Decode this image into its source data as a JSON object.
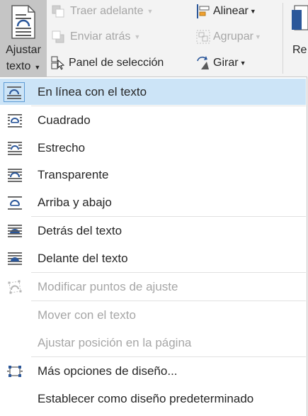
{
  "ribbon": {
    "ajustar_texto": {
      "line1": "Ajustar",
      "line2": "texto",
      "icon": "wrap-text-icon"
    },
    "traer_adelante": {
      "label": "Traer adelante",
      "icon": "bring-forward-icon",
      "enabled": false
    },
    "enviar_atras": {
      "label": "Enviar atrás",
      "icon": "send-backward-icon",
      "enabled": false
    },
    "panel_seleccion": {
      "label": "Panel de selección",
      "icon": "selection-pane-icon",
      "enabled": true
    },
    "alinear": {
      "label": "Alinear",
      "icon": "align-icon",
      "enabled": true
    },
    "agrupar": {
      "label": "Agrupar",
      "icon": "group-icon",
      "enabled": false
    },
    "girar": {
      "label": "Girar",
      "icon": "rotate-icon",
      "enabled": true
    },
    "recortar_partial": {
      "label": "Re",
      "icon": "crop-icon"
    }
  },
  "menu": {
    "items": [
      {
        "label": "En línea con el texto",
        "icon": "wrap-inline-icon",
        "enabled": true,
        "selected": true
      },
      {
        "label": "Cuadrado",
        "icon": "wrap-square-icon",
        "enabled": true
      },
      {
        "label": "Estrecho",
        "icon": "wrap-tight-icon",
        "enabled": true
      },
      {
        "label": "Transparente",
        "icon": "wrap-through-icon",
        "enabled": true
      },
      {
        "label": "Arriba y abajo",
        "icon": "wrap-top-bottom-icon",
        "enabled": true
      },
      {
        "label": "Detrás del texto",
        "icon": "behind-text-icon",
        "enabled": true
      },
      {
        "label": "Delante del texto",
        "icon": "in-front-of-text-icon",
        "enabled": true
      },
      {
        "label": "Modificar puntos de ajuste",
        "icon": "edit-wrap-points-icon",
        "enabled": false
      },
      {
        "label": "Mover con el texto",
        "enabled": false
      },
      {
        "label": "Ajustar posición en la página",
        "enabled": false
      },
      {
        "label": "Más opciones de diseño...",
        "icon": "more-layout-options-icon",
        "enabled": true
      },
      {
        "label": "Establecer como diseño predeterminado",
        "enabled": true
      }
    ]
  },
  "colors": {
    "accent_blue": "#2b579a",
    "selected_bg": "#cce4f7",
    "disabled_text": "#a6a6a6",
    "pressed_button": "#c5c5c5"
  }
}
